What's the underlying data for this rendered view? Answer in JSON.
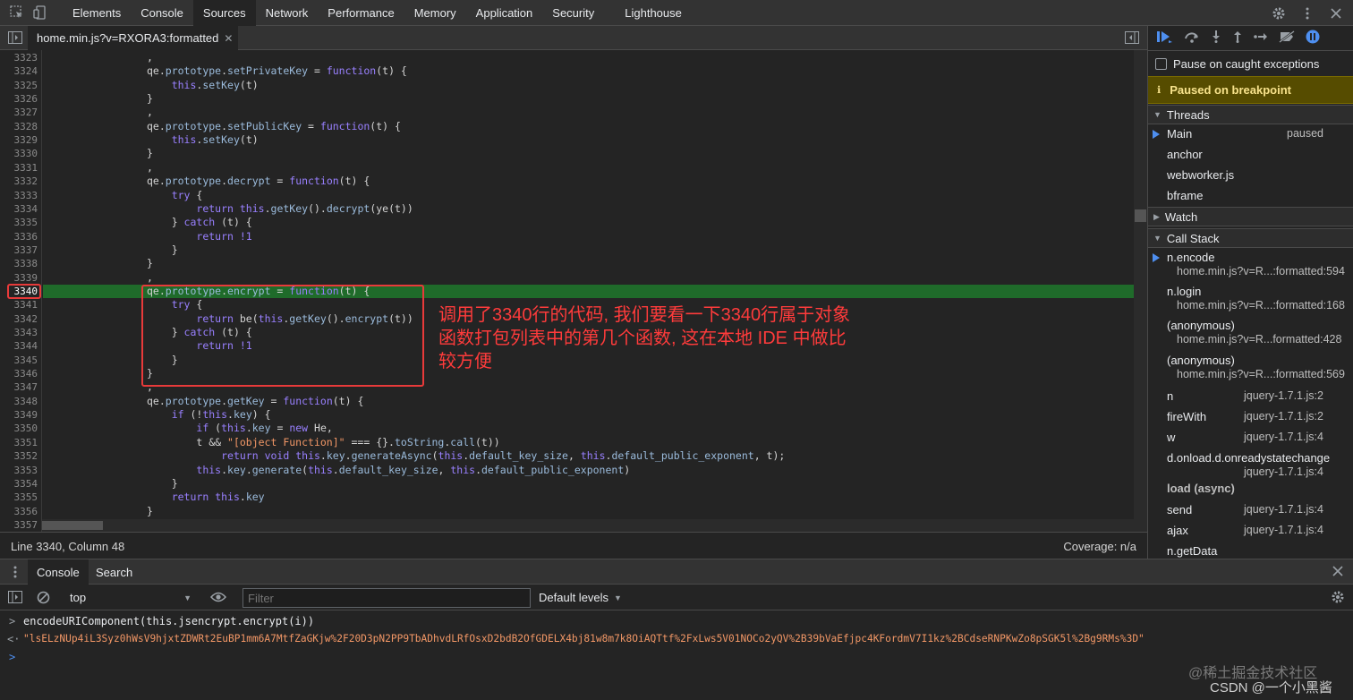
{
  "toolbar": {
    "tabs": [
      "Elements",
      "Console",
      "Sources",
      "Network",
      "Performance",
      "Memory",
      "Application",
      "Security",
      "Lighthouse"
    ],
    "active_tab": "Sources"
  },
  "editor": {
    "file_tab": "home.min.js?v=RXORA3:formatted",
    "lines": [
      {
        "n": "3323",
        "code": ","
      },
      {
        "n": "3324",
        "code": "qe.prototype.setPrivateKey = function(t) {"
      },
      {
        "n": "3325",
        "code": "    this.setKey(t)"
      },
      {
        "n": "3326",
        "code": "}"
      },
      {
        "n": "3327",
        "code": ","
      },
      {
        "n": "3328",
        "code": "qe.prototype.setPublicKey = function(t) {"
      },
      {
        "n": "3329",
        "code": "    this.setKey(t)"
      },
      {
        "n": "3330",
        "code": "}"
      },
      {
        "n": "3331",
        "code": ","
      },
      {
        "n": "3332",
        "code": "qe.prototype.decrypt = function(t) {"
      },
      {
        "n": "3333",
        "code": "    try {"
      },
      {
        "n": "3334",
        "code": "        return this.getKey().decrypt(ye(t))"
      },
      {
        "n": "3335",
        "code": "    } catch (t) {"
      },
      {
        "n": "3336",
        "code": "        return !1"
      },
      {
        "n": "3337",
        "code": "    }"
      },
      {
        "n": "3338",
        "code": "}"
      },
      {
        "n": "3339",
        "code": ","
      },
      {
        "n": "3340",
        "code": "qe.prototype.encrypt = function(t) {"
      },
      {
        "n": "3341",
        "code": "    try {"
      },
      {
        "n": "3342",
        "code": "        return be(this.getKey().encrypt(t))"
      },
      {
        "n": "3343",
        "code": "    } catch (t) {"
      },
      {
        "n": "3344",
        "code": "        return !1"
      },
      {
        "n": "3345",
        "code": "    }"
      },
      {
        "n": "3346",
        "code": "}"
      },
      {
        "n": "3347",
        "code": ","
      },
      {
        "n": "3348",
        "code": "qe.prototype.getKey = function(t) {"
      },
      {
        "n": "3349",
        "code": "    if (!this.key) {"
      },
      {
        "n": "3350",
        "code": "        if (this.key = new He,"
      },
      {
        "n": "3351",
        "code": "        t && \"[object Function]\" === {}.toString.call(t))"
      },
      {
        "n": "3352",
        "code": "            return void this.key.generateAsync(this.default_key_size, this.default_public_exponent, t);"
      },
      {
        "n": "3353",
        "code": "        this.key.generate(this.default_key_size, this.default_public_exponent)"
      },
      {
        "n": "3354",
        "code": "    }"
      },
      {
        "n": "3355",
        "code": "    return this.key"
      },
      {
        "n": "3356",
        "code": "}"
      },
      {
        "n": "3357",
        "code": ""
      }
    ],
    "annotation": "调用了3340行的代码, 我们要看一下3340行属于对象函数打包列表中的第几个函数, 这在本地 IDE 中做比较方便",
    "status_position": "Line 3340, Column 48",
    "status_coverage": "Coverage: n/a"
  },
  "sidebar": {
    "pause_on_caught": "Pause on caught exceptions",
    "paused_banner": "Paused on breakpoint",
    "threads_label": "Threads",
    "threads": [
      {
        "name": "Main",
        "state": "paused"
      },
      {
        "name": "anchor",
        "state": ""
      },
      {
        "name": "webworker.js",
        "state": ""
      },
      {
        "name": "bframe",
        "state": ""
      }
    ],
    "watch_label": "Watch",
    "callstack_label": "Call Stack",
    "callstack": [
      {
        "name": "n.encode",
        "loc": "home.min.js?v=R...:formatted:594"
      },
      {
        "name": "n.login",
        "loc": "home.min.js?v=R...:formatted:168"
      },
      {
        "name": "(anonymous)",
        "loc": "home.min.js?v=R...formatted:428"
      },
      {
        "name": "(anonymous)",
        "loc": "home.min.js?v=R...:formatted:569"
      },
      {
        "name": "n",
        "loc": "jquery-1.7.1.js:2"
      },
      {
        "name": "fireWith",
        "loc": "jquery-1.7.1.js:2"
      },
      {
        "name": "w",
        "loc": "jquery-1.7.1.js:4"
      },
      {
        "name": "d.onload.d.onreadystatechange",
        "loc": "jquery-1.7.1.js:4"
      },
      {
        "name": "load (async)",
        "loc": ""
      },
      {
        "name": "send",
        "loc": "jquery-1.7.1.js:4"
      },
      {
        "name": "ajax",
        "loc": "jquery-1.7.1.js:4"
      },
      {
        "name": "n.getData",
        "loc": ""
      }
    ]
  },
  "drawer": {
    "tabs": [
      "Console",
      "Search"
    ],
    "context": "top",
    "filter_placeholder": "Filter",
    "levels": "Default levels",
    "input_line": "encodeURIComponent(this.jsencrypt.encrypt(i))",
    "output_line": "\"lsELzNUp4iL3Syz0hWsV9hjxtZDWRt2EuBP1mm6A7MtfZaGKjw%2F20D3pN2PP9TbADhvdLRfOsxD2bdB2OfGDELX4bj81w8m7k8OiAQTtf%2FxLws5V01NOCo2yQV%2B39bVaEfjpc4KFordmV7I1kz%2BCdseRNPKwZo8pSGK5l%2Bg9RMs%3D\""
  },
  "watermarks": [
    "@稀土掘金技术社区",
    "CSDN @一个小黑酱"
  ]
}
